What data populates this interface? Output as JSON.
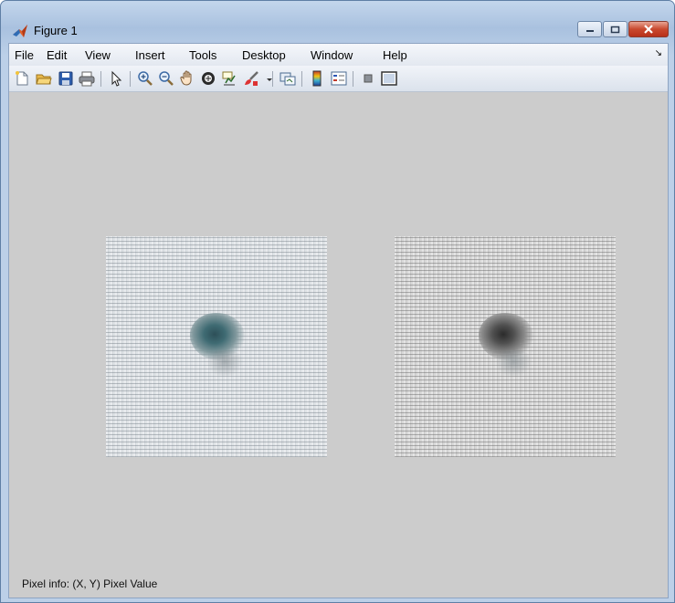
{
  "window": {
    "title": "Figure 1"
  },
  "menu": {
    "items": [
      "File",
      "Edit",
      "View",
      "Insert",
      "Tools",
      "Desktop",
      "Window",
      "Help"
    ],
    "dock_arrow": "↘"
  },
  "toolbar": {
    "buttons": [
      "new-figure-icon",
      "open-file-icon",
      "save-icon",
      "print-icon",
      "edit-plot-icon",
      "zoom-in-icon",
      "zoom-out-icon",
      "pan-icon",
      "rotate-3d-icon",
      "data-cursor-icon",
      "brush-icon",
      "link-plot-icon",
      "insert-colorbar-icon",
      "insert-legend-icon",
      "hide-plot-tools-icon",
      "show-plot-tools-icon"
    ]
  },
  "images": [
    {
      "name": "original-image",
      "mode": "color"
    },
    {
      "name": "grayscale-image",
      "mode": "grayscale"
    }
  ],
  "status": {
    "pixel_info": "Pixel info: (X, Y)  Pixel Value"
  }
}
